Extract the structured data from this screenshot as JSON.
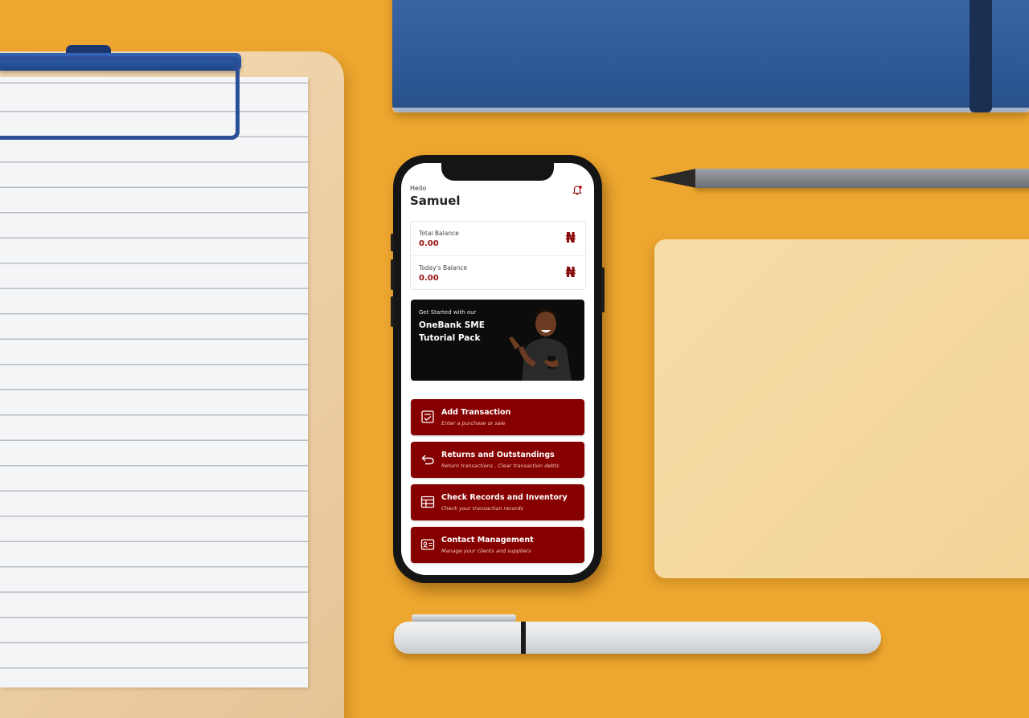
{
  "app": {
    "greeting": "Hello",
    "username": "Samuel",
    "notification_icon": "bell-icon"
  },
  "balances": [
    {
      "label": "Total Balance",
      "value": "0.00",
      "currency_symbol": "₦"
    },
    {
      "label": "Today's Balance",
      "value": "0.00",
      "currency_symbol": "₦"
    }
  ],
  "banner": {
    "subtitle": "Get Started with our",
    "title": "OneBank SME Tutorial Pack"
  },
  "actions": [
    {
      "title": "Add Transaction",
      "subtitle": "Enter a purchase or sale",
      "icon": "checklist-icon"
    },
    {
      "title": "Returns and Outstandings",
      "subtitle": "Return transactions , Clear transaction debts",
      "icon": "return-arrow-icon"
    },
    {
      "title": "Check Records and Inventory",
      "subtitle": "Check your transaction records",
      "icon": "table-icon"
    },
    {
      "title": "Contact Management",
      "subtitle": "Manage your clients and suppliers",
      "icon": "contact-card-icon"
    }
  ],
  "colors": {
    "accent": "#870000",
    "balance_value": "#9a0f0f",
    "background": "#eda62f"
  }
}
